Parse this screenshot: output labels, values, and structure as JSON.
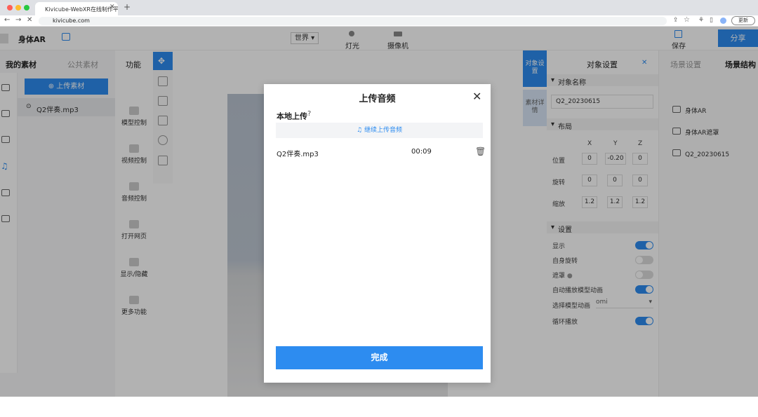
{
  "browser": {
    "tab_title": "Kivicube-WebXR在线制作平台",
    "url": "kivicube.com",
    "update_label": "更新",
    "nav": {
      "back": "←",
      "forward": "→",
      "close": "✕"
    }
  },
  "app": {
    "project_title": "身体AR",
    "world_select": "世界",
    "light_label": "灯光",
    "camera_label": "摄像机",
    "save_label": "保存",
    "share_label": "分享"
  },
  "left_panel": {
    "tabs": [
      "我的素材",
      "公共素材"
    ],
    "upload_button": "上传素材",
    "asset_item": "Q2伴奏.mp3"
  },
  "function_panel": {
    "title": "功能",
    "items": [
      "模型控制",
      "视频控制",
      "音频控制",
      "打开网页",
      "显示/隐藏",
      "更多功能"
    ]
  },
  "right_panel": {
    "side_tabs": [
      "对象设置",
      "素材详情"
    ],
    "title": "对象设置",
    "name_section": "对象名称",
    "name_value": "Q2_20230615",
    "layout_section": "布局",
    "axes": [
      "X",
      "Y",
      "Z"
    ],
    "rows": [
      {
        "label": "位置",
        "values": [
          "0",
          "-0.20",
          "0"
        ]
      },
      {
        "label": "旋转",
        "values": [
          "0",
          "0",
          "0"
        ]
      },
      {
        "label": "缩放",
        "values": [
          "1.2",
          "1.2",
          "1.2"
        ]
      }
    ],
    "settings_section": "设置",
    "settings": [
      {
        "label": "显示",
        "on": true
      },
      {
        "label": "自身旋转",
        "on": false
      },
      {
        "label": "遮罩",
        "on": false
      },
      {
        "label": "自动播放模型动画",
        "on": true
      }
    ],
    "animation_select_label": "选择模型动画",
    "animation_select_value": "omi",
    "loop_label": "循环播放",
    "loop_on": true
  },
  "scene_panel": {
    "tabs": [
      "场景设置",
      "场景结构"
    ],
    "items": [
      "身体AR",
      "身体AR遮罩",
      "Q2_20230615"
    ]
  },
  "modal": {
    "title": "上传音频",
    "local_upload": "本地上传",
    "continue_upload": "继续上传音频",
    "file_name": "Q2伴奏.mp3",
    "file_duration": "00:09",
    "done_label": "完成"
  },
  "colors": {
    "accent": "#2d8cf0",
    "toggle_on": "#2d8cf0",
    "toggle_off": "#dcdcdc"
  }
}
